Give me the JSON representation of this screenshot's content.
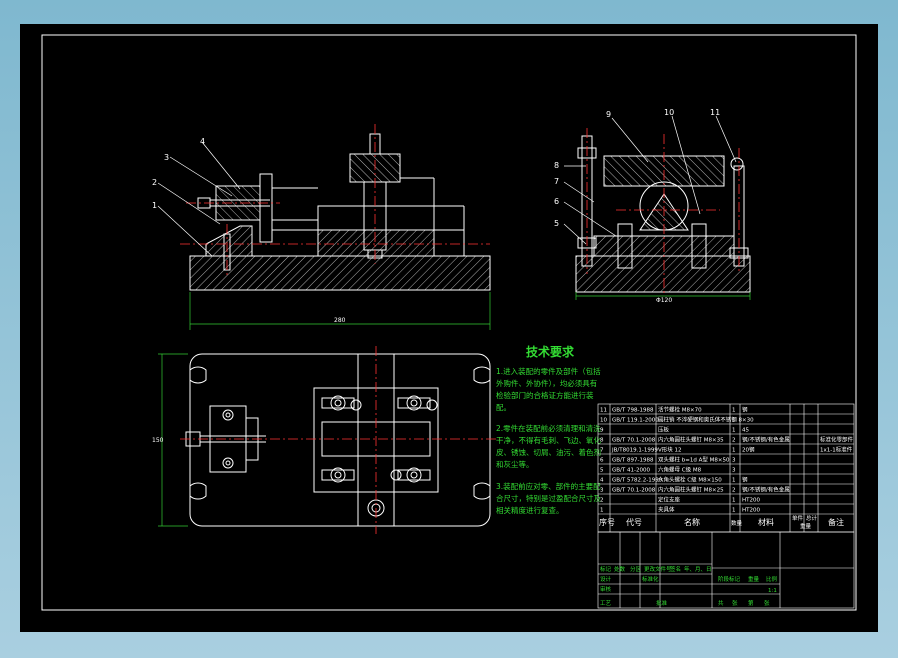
{
  "colors": {
    "background": "#000000",
    "outline": "#ffffff",
    "centerline": "#ff3333",
    "dimension": "#33cc33",
    "note_text": "#33dd33",
    "hatch": "#ffffff",
    "frame_outer": "#7fb8cf"
  },
  "views": {
    "front": {
      "callouts": [
        "1",
        "2",
        "3",
        "4"
      ],
      "dimension": "280"
    },
    "side": {
      "callouts": [
        "5",
        "6",
        "7",
        "8",
        "9",
        "10",
        "11"
      ],
      "dimension": "Φ120"
    },
    "top": {
      "dimension": "150"
    }
  },
  "technical_requirements": {
    "title": "技术要求",
    "lines": [
      "1.进入装配的零件及部件（包括",
      "外购件、外协件），均必须具有",
      "检验部门的合格证方能进行装",
      "配。",
      "2.零件在装配前必须清理和清洗",
      "干净，不得有毛刺、飞边、氧化",
      "皮、锈蚀、切屑、油污、着色剂",
      "和灰尘等。",
      "3.装配前应对零、部件的主要配",
      "合尺寸，特别是过盈配合尺寸及",
      "相关精度进行复查。"
    ]
  },
  "bom": {
    "rows": [
      {
        "no": "11",
        "code": "GB/T 798-1988",
        "name": "活节螺栓 M8×70",
        "qty": "1",
        "material": "钢",
        "weight": "",
        "note": ""
      },
      {
        "no": "10",
        "code": "GB/T 119.1-2000",
        "name": "圆柱销 不淬硬钢和奥氏体不锈钢 8×30",
        "qty": "1",
        "material": "",
        "weight": "",
        "note": ""
      },
      {
        "no": "9",
        "code": "",
        "name": "压板",
        "qty": "1",
        "material": "45",
        "weight": "",
        "note": ""
      },
      {
        "no": "8",
        "code": "GB/T 70.1-2008",
        "name": "内六角圆柱头螺钉 M8×35",
        "qty": "2",
        "material": "钢/不锈钢/有色金属",
        "weight": "",
        "note": "标准化零部件"
      },
      {
        "no": "7",
        "code": "JB/T8019.1-1999",
        "name": "V形块 12",
        "qty": "1",
        "material": "20钢",
        "weight": "",
        "note": "1x1-1标准件"
      },
      {
        "no": "6",
        "code": "GB/T 897-1988",
        "name": "双头螺柱 b=1d A型 M8×50",
        "qty": "3",
        "material": "",
        "weight": "",
        "note": ""
      },
      {
        "no": "5",
        "code": "GB/T 41-2000",
        "name": "六角螺母 C级 M8",
        "qty": "3",
        "material": "",
        "weight": "",
        "note": ""
      },
      {
        "no": "4",
        "code": "GB/T 5782.2-1999",
        "name": "六角头螺栓 C级 M8×150",
        "qty": "1",
        "material": "钢",
        "weight": "",
        "note": ""
      },
      {
        "no": "3",
        "code": "GB/T 70.1-2008",
        "name": "内六角圆柱头螺钉 M8×25",
        "qty": "2",
        "material": "钢/不锈钢/有色金属",
        "weight": "",
        "note": ""
      },
      {
        "no": "2",
        "code": "",
        "name": "定位支座",
        "qty": "1",
        "material": "HT200",
        "weight": "",
        "note": ""
      },
      {
        "no": "1",
        "code": "",
        "name": "夹具体",
        "qty": "1",
        "material": "HT200",
        "weight": "",
        "note": ""
      }
    ],
    "header": {
      "no": "序号",
      "code": "代号",
      "name": "名称",
      "qty": "数量",
      "material": "材料",
      "unit_weight": "单件",
      "total_weight": "总计",
      "weight": "重量",
      "note": "备注"
    }
  },
  "title_block": {
    "row_labels": [
      "标记",
      "处数",
      "分区",
      "更改文件号",
      "签名",
      "年、月、日"
    ],
    "design": "设计",
    "standardize": "标准化",
    "review": "审核",
    "process": "工艺",
    "approve": "批准",
    "stage": "阶段标记",
    "weight": "重量",
    "scale": "比例",
    "scale_value": "1:1",
    "sheets": [
      "共",
      "张",
      "第",
      "张"
    ]
  }
}
